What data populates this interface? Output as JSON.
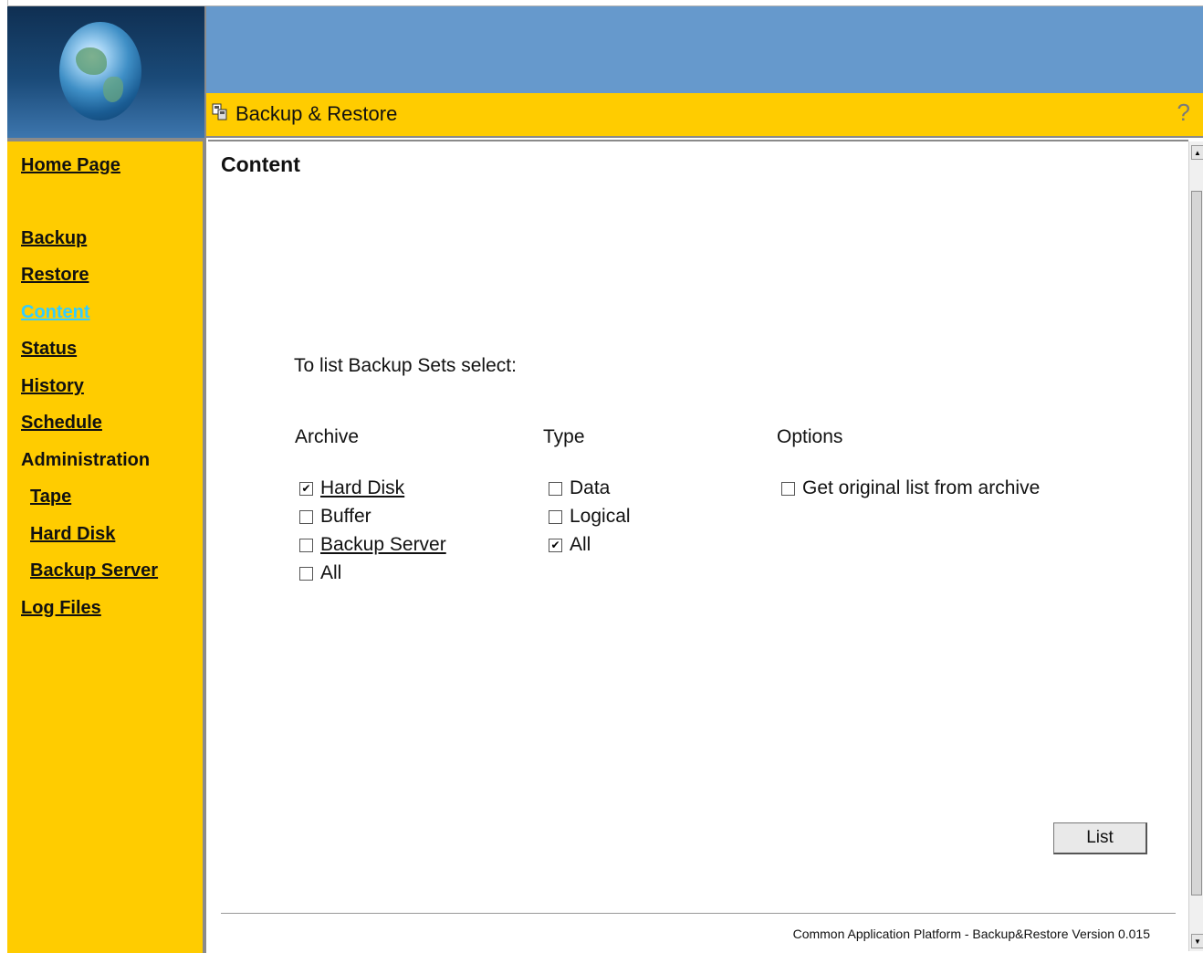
{
  "header": {
    "title": "Backup & Restore",
    "help_icon": "question-mark-icon",
    "app_icon": "backup-restore-icon",
    "logo": "globe-logo",
    "colors": {
      "top_band": "#6699cc",
      "title_bar": "#ffcc00",
      "sidebar": "#ffcc00",
      "active_link": "#33ccff"
    }
  },
  "sidebar": {
    "items": [
      {
        "label": "Home Page"
      },
      {
        "label": "Backup"
      },
      {
        "label": "Restore"
      },
      {
        "label": "Content",
        "active": true
      },
      {
        "label": "Status"
      },
      {
        "label": "History"
      },
      {
        "label": "Schedule"
      },
      {
        "label": "Administration"
      },
      {
        "label": "Tape"
      },
      {
        "label": "Hard Disk"
      },
      {
        "label": "Backup Server"
      },
      {
        "label": "Log Files"
      }
    ]
  },
  "main": {
    "page_title": "Content",
    "instruction": "To list Backup Sets select:",
    "columns": {
      "archive": {
        "heading": "Archive",
        "options": [
          {
            "label": "Hard Disk",
            "checked": true
          },
          {
            "label": "Buffer",
            "checked": false
          },
          {
            "label": "Backup Server",
            "checked": false
          },
          {
            "label": "All",
            "checked": false
          }
        ]
      },
      "type": {
        "heading": "Type",
        "options": [
          {
            "label": "Data",
            "checked": false
          },
          {
            "label": "Logical",
            "checked": false
          },
          {
            "label": "All",
            "checked": true
          }
        ]
      },
      "options": {
        "heading": "Options",
        "options": [
          {
            "label": "Get original list from archive",
            "checked": false
          }
        ]
      }
    },
    "list_button": "List",
    "footer": "Common Application Platform - Backup&Restore Version 0.015"
  }
}
